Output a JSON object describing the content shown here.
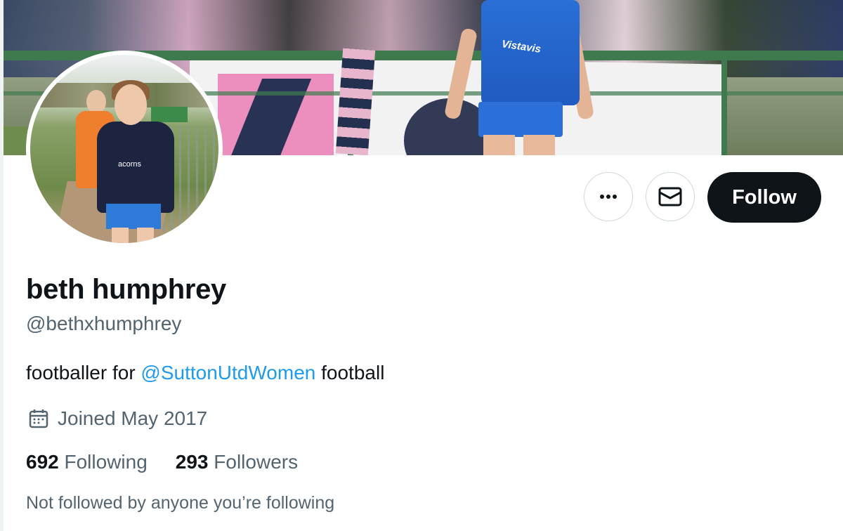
{
  "profile": {
    "name": "beth humphrey",
    "handle": "@bethxhumphrey",
    "bio_prefix": "footballer for ",
    "bio_mention": "@SuttonUtdWomen",
    "bio_suffix": " football",
    "joined": "Joined May 2017",
    "following_count": "692",
    "following_label": "Following",
    "followers_count": "293",
    "followers_label": "Followers",
    "not_followed_text": "Not followed by anyone you’re following"
  },
  "actions": {
    "follow_label": "Follow",
    "more_icon": "more-horizontal-icon",
    "message_icon": "envelope-icon"
  },
  "banner": {
    "sponsor_text": "Vistavis"
  },
  "avatar": {
    "shirt_text": "acorns"
  },
  "colors": {
    "accent": "#1d9bf0",
    "text_primary": "#0f1419",
    "text_secondary": "#536471",
    "button_dark": "#0f1419",
    "border": "#cfd9de"
  }
}
